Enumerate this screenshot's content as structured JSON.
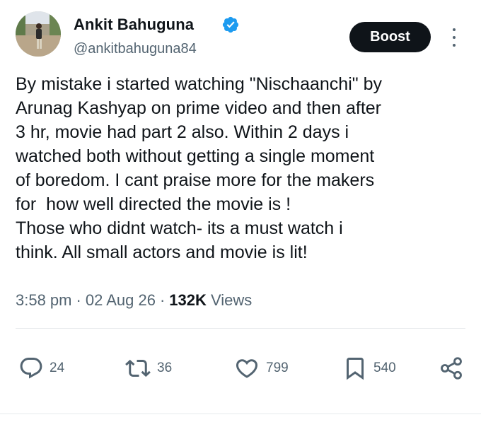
{
  "author": {
    "name": "Ankit Bahuguna",
    "handle": "@ankitbahuguna84",
    "verified": true
  },
  "header": {
    "boost_label": "Boost",
    "more_icon": "more-vertical-icon"
  },
  "tweet": {
    "text": "By mistake i started watching \"Nischaanchi\" by\nArunag Kashyap on prime video and then after\n3 hr, movie had part 2 also. Within 2 days i\nwatched both without getting a single moment\nof boredom. I cant praise more for the makers\nfor  how well directed the movie is !\nThose who didnt watch- its a must watch i\nthink. All small actors and movie is lit!",
    "time": "3:58 pm",
    "date": "02 Aug 26",
    "views_count": "132K",
    "views_label": "Views",
    "separator": "·"
  },
  "actions": {
    "replies": "24",
    "reposts": "36",
    "likes": "799",
    "bookmarks": "540"
  },
  "colors": {
    "text": "#0f1419",
    "secondary": "#536471",
    "verified": "#1d9bf0",
    "divider": "#e6e9ec"
  }
}
